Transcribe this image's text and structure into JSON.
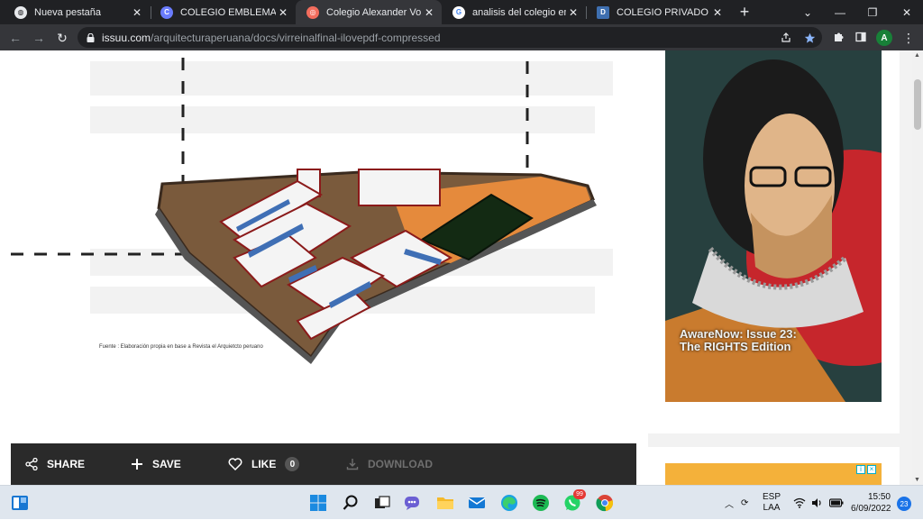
{
  "browser": {
    "tabs": [
      {
        "title": "Nueva pestaña",
        "active": false,
        "favicon": "chrome-globe-icon"
      },
      {
        "title": "COLEGIO EMBLEMATICO |",
        "active": false,
        "favicon": "circle-c-icon"
      },
      {
        "title": "Colegio Alexander Von H",
        "active": true,
        "favicon": "issuu-icon"
      },
      {
        "title": "analisis del colegio emble",
        "active": false,
        "favicon": "google-icon"
      },
      {
        "title": "COLEGIO PRIVADO ALEXA",
        "active": false,
        "favicon": "d-icon"
      }
    ],
    "tab_close": "✕",
    "new_tab": "+",
    "url_host": "issuu.com",
    "url_path": "/arquitecturaperuana/docs/virreinalfinal-ilovepdf-compressed",
    "profile_initial": "A",
    "accent": "#8ab4f8"
  },
  "document": {
    "caption": "Fuente : Elaboración propia en base a Revista el Arquietcto peruano"
  },
  "ads": {
    "main_text_line1": "AwareNow: Issue 23:",
    "main_text_line2": "The RIGHTS Edition"
  },
  "actions": {
    "share": "SHARE",
    "save": "SAVE",
    "like": "LIKE",
    "like_count": "0",
    "download": "DOWNLOAD"
  },
  "taskbar": {
    "language": "ESP",
    "layout": "LAA",
    "time": "15:50",
    "date": "6/09/2022",
    "notifications": "23",
    "whatsapp_badge": "99"
  }
}
